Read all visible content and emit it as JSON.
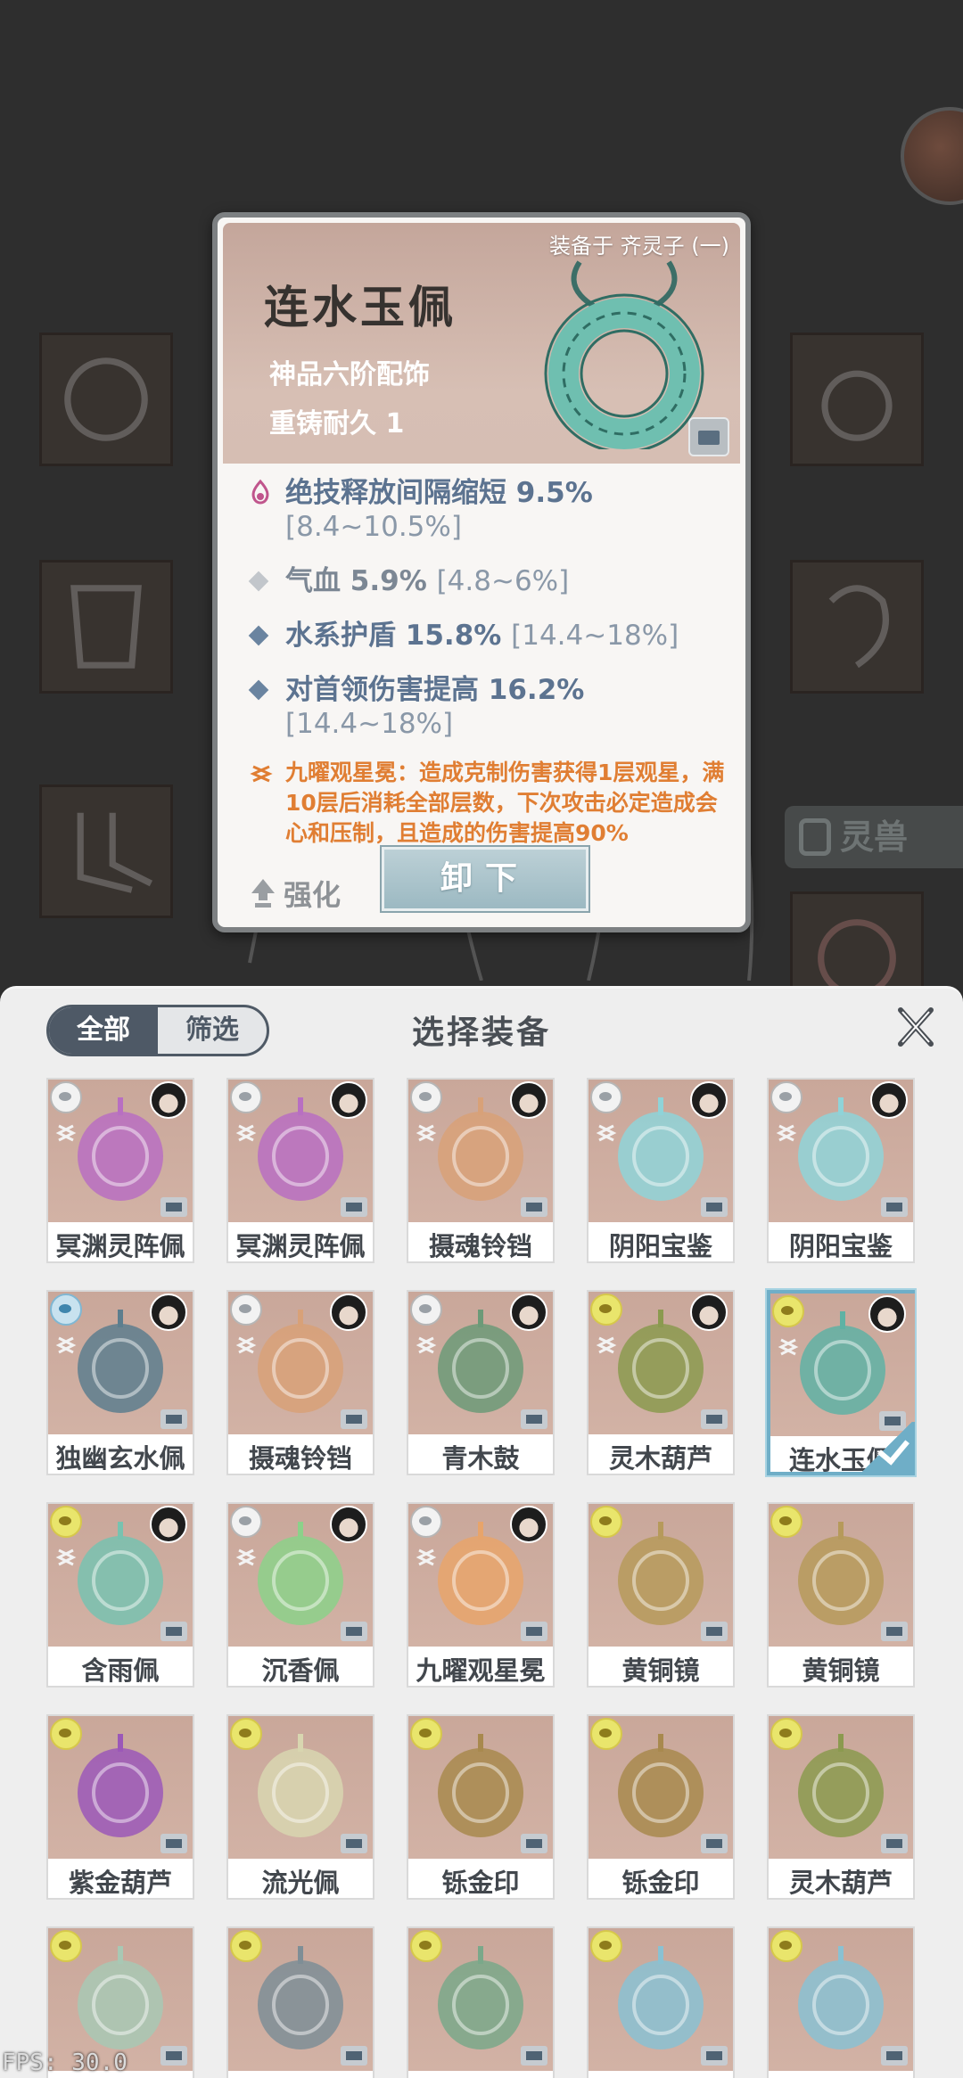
{
  "background": {
    "side_tab_label": "灵兽"
  },
  "detail": {
    "equipped_by": "装备于 齐灵子 (一)",
    "name": "连水玉佩",
    "grade": "神品六阶配饰",
    "durability": "重铸耐久 1",
    "stats": [
      {
        "text": "绝技释放间隔缩短 9.5%",
        "range": "[8.4~10.5%]"
      },
      {
        "text": "气血 5.9%",
        "range": "[4.8~6%]"
      },
      {
        "text": "水系护盾 15.8%",
        "range": "[14.4~18%]"
      },
      {
        "text": "对首领伤害提高 16.2%",
        "range": "[14.4~18%]"
      }
    ],
    "skill": "九曜观星冕：造成克制伤害获得1层观星，满10层后消耗全部层数，下次攻击必定造成会心和压制，且造成的伤害提高90%",
    "strengthen_label": "强化",
    "unequip_label": "卸下"
  },
  "panel": {
    "title": "选择装备",
    "filter_all": "全部",
    "filter_screen": "筛选",
    "items": [
      {
        "name": "冥渊灵阵佩",
        "tag": "grey",
        "avatar": true,
        "color": "#b86fc2"
      },
      {
        "name": "冥渊灵阵佩",
        "tag": "grey",
        "avatar": true,
        "color": "#b86fc2"
      },
      {
        "name": "摄魂铃铛",
        "tag": "grey",
        "avatar": true,
        "color": "#d8a178"
      },
      {
        "name": "阴阳宝鉴",
        "tag": "grey",
        "avatar": true,
        "color": "#8fd3d8"
      },
      {
        "name": "阴阳宝鉴",
        "tag": "grey",
        "avatar": true,
        "color": "#8fd3d8"
      },
      {
        "name": "独幽玄水佩",
        "tag": "blue",
        "avatar": true,
        "color": "#5d7e8e"
      },
      {
        "name": "摄魂铃铛",
        "tag": "grey",
        "avatar": true,
        "color": "#d8a178"
      },
      {
        "name": "青木鼓",
        "tag": "grey",
        "avatar": true,
        "color": "#6c9a78"
      },
      {
        "name": "灵木葫芦",
        "tag": "yellow",
        "avatar": true,
        "color": "#8b9a4f"
      },
      {
        "name": "连水玉佩",
        "tag": "yellow",
        "avatar": true,
        "color": "#5fb2a4",
        "selected": true
      },
      {
        "name": "含雨佩",
        "tag": "yellow",
        "avatar": true,
        "color": "#78c2b0"
      },
      {
        "name": "沉香佩",
        "tag": "grey",
        "avatar": true,
        "color": "#8cd18a"
      },
      {
        "name": "九曜观星冕",
        "tag": "grey",
        "avatar": true,
        "color": "#e7a46b"
      },
      {
        "name": "黄铜镜",
        "tag": "yellow",
        "avatar": false,
        "color": "#b69a5b"
      },
      {
        "name": "黄铜镜",
        "tag": "yellow",
        "avatar": false,
        "color": "#b69a5b"
      },
      {
        "name": "紫金葫芦",
        "tag": "yellow",
        "avatar": false,
        "color": "#9b58b8"
      },
      {
        "name": "流光佩",
        "tag": "yellow",
        "avatar": false,
        "color": "#d8d6b0"
      },
      {
        "name": "铄金印",
        "tag": "yellow",
        "avatar": false,
        "color": "#a8894e"
      },
      {
        "name": "铄金印",
        "tag": "yellow",
        "avatar": false,
        "color": "#a8894e"
      },
      {
        "name": "灵木葫芦",
        "tag": "yellow",
        "avatar": false,
        "color": "#8b9a4f"
      },
      {
        "name": "",
        "tag": "yellow",
        "avatar": false,
        "color": "#a8c8b4"
      },
      {
        "name": "",
        "tag": "yellow",
        "avatar": false,
        "color": "#7e8e96"
      },
      {
        "name": "",
        "tag": "yellow",
        "avatar": false,
        "color": "#7aa88a"
      },
      {
        "name": "",
        "tag": "yellow",
        "avatar": false,
        "color": "#8ac1d2"
      },
      {
        "name": "",
        "tag": "yellow",
        "avatar": false,
        "color": "#8ac1d2"
      }
    ]
  },
  "fps": "FPS: 30.0"
}
